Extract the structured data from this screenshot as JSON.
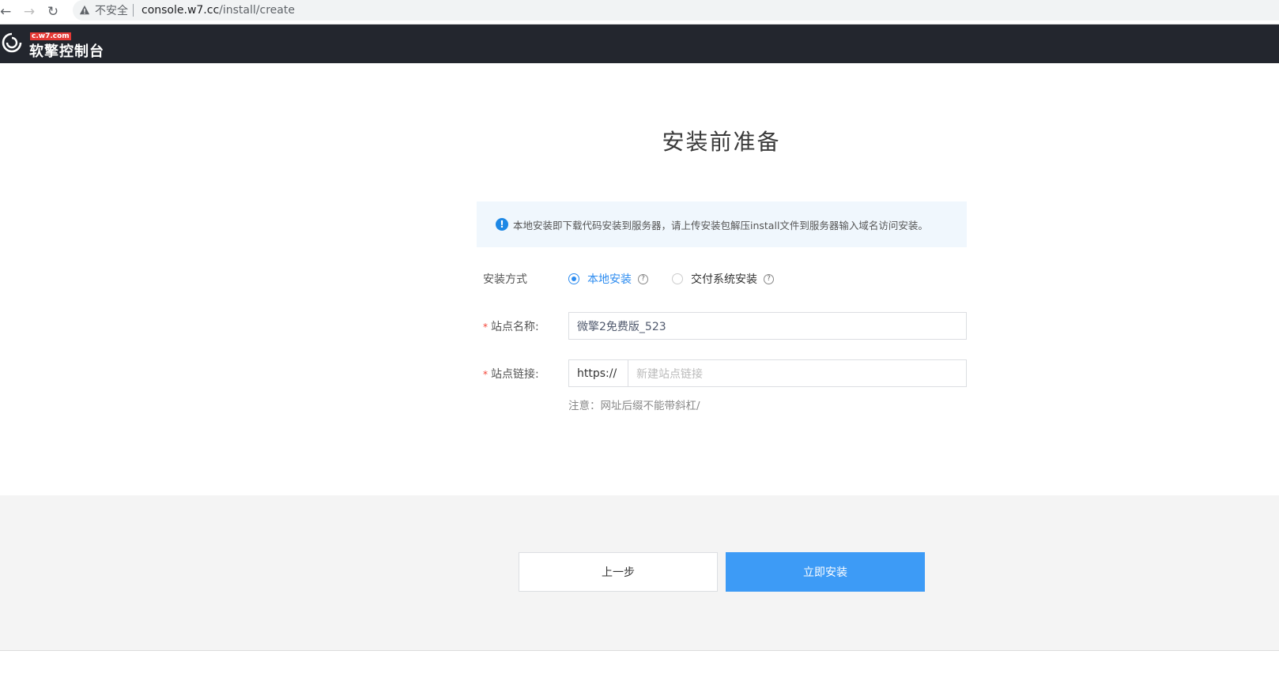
{
  "browser": {
    "back_icon": "arrow-left-icon",
    "forward_icon": "arrow-right-icon",
    "reload_icon": "reload-icon",
    "warning_icon": "warning-icon",
    "security_text": "不安全",
    "url_host": "console.w7.cc",
    "url_path": "/install/create"
  },
  "header": {
    "logo_tag": "c.w7.com",
    "logo_text": "软擎控制台"
  },
  "main": {
    "title": "安装前准备",
    "notice": "本地安装即下载代码安装到服务器，请上传安装包解压install文件到服务器输入域名访问安装。",
    "install_method": {
      "label": "安装方式",
      "options": [
        {
          "label": "本地安装",
          "checked": true
        },
        {
          "label": "交付系统安装",
          "checked": false
        }
      ]
    },
    "site_name": {
      "label": "站点名称:",
      "value": "微擎2免费版_523"
    },
    "site_url": {
      "label": "站点链接:",
      "prefix": "https://",
      "placeholder": "新建站点链接",
      "hint": "注意：网址后缀不能带斜杠/"
    }
  },
  "footer": {
    "prev_label": "上一步",
    "install_label": "立即安装"
  },
  "colors": {
    "primary": "#3d9bf6",
    "header_bg": "#23262e",
    "notice_bg": "#f0f7fd"
  }
}
